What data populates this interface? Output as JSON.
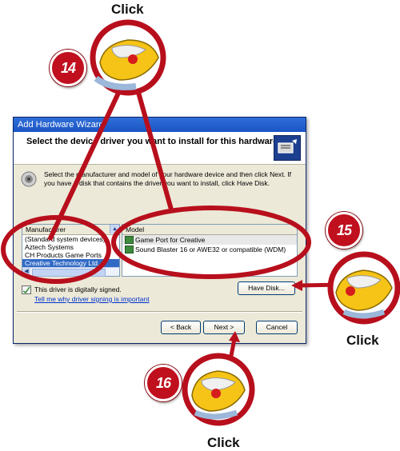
{
  "callouts": {
    "click_top": "Click",
    "click_right": "Click",
    "click_bottom": "Click",
    "step_14": "14",
    "step_15": "15",
    "step_16": "16"
  },
  "dialog": {
    "title": "Add Hardware Wizard",
    "header_text": "Select the device driver you want to install for this hardware.",
    "intro_text": "Select the manufacturer and model of your hardware device and then click Next. If you have a disk that contains the driver you want to install, click Have Disk.",
    "manufacturer_header": "Manufacturer",
    "manufacturers": [
      "(Standard system devices)",
      "Aztech Systems",
      "CH Products Game Ports",
      "Creative Technology Ltd."
    ],
    "selected_manufacturer_index": 3,
    "model_header": "Model",
    "models": [
      "Game Port for Creative",
      "Sound Blaster 16 or AWE32 or compatible (WDM)"
    ],
    "signed_text": "This driver is digitally signed.",
    "signing_link": "Tell me why driver signing is important",
    "have_disk_button": "Have Disk...",
    "back_button": "< Back",
    "next_button": "Next >",
    "cancel_button": "Cancel"
  },
  "colors": {
    "callout_red": "#b80f1d",
    "titlebar_blue": "#1b54c5",
    "selection_blue": "#316ac5"
  }
}
